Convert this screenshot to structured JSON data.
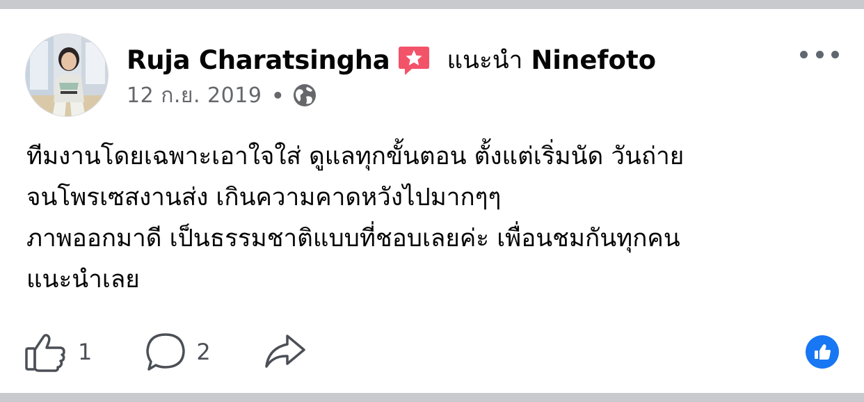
{
  "post": {
    "author": "Ruja Charatsingha",
    "recommend_label": "แนะนำ",
    "page": "Ninefoto",
    "date": "12 ก.ย. 2019",
    "separator": "•",
    "privacy_icon": "globe-icon",
    "badge_icon": "recommendation-star-icon",
    "body_lines": [
      "ทีมงานโดยเฉพาะเอาใจใส่ ดูแลทุกขั้นตอน ตั้งแต่เริ่มนัด วันถ่าย",
      "จนโพรเซสงานส่ง เกินความคาดหวังไปมากๆๆ",
      "ภาพออกมาดี เป็นธรรมชาติแบบที่ชอบเลยค่ะ เพื่อนชมกันทุกคน",
      "แนะนำเลย"
    ]
  },
  "actions": {
    "like_count": "1",
    "comment_count": "2"
  },
  "colors": {
    "accent_blue": "#1877f2",
    "badge_red": "#f35369",
    "secondary_text": "#65676b",
    "divider": "#c9cace"
  }
}
